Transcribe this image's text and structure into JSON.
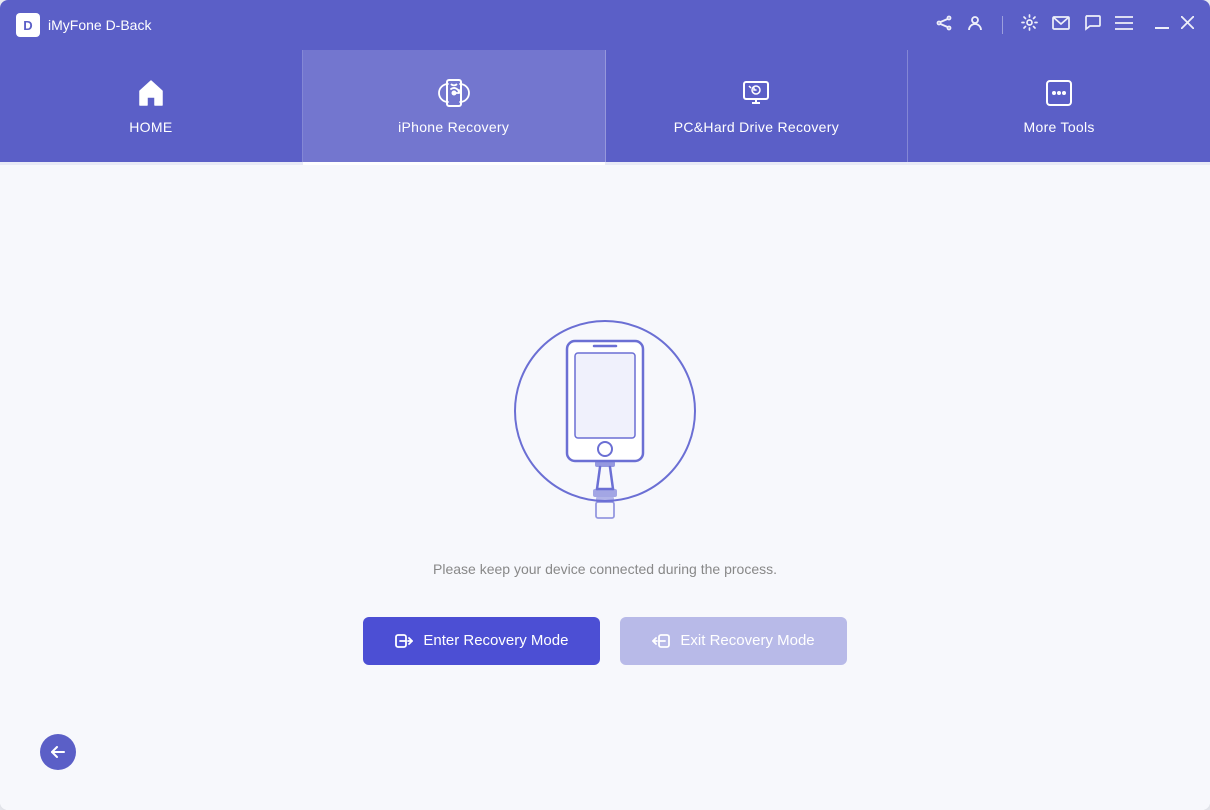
{
  "titlebar": {
    "logo_letter": "D",
    "app_name": "iMyFone D-Back"
  },
  "navbar": {
    "items": [
      {
        "id": "home",
        "label": "HOME",
        "active": false
      },
      {
        "id": "iphone-recovery",
        "label": "iPhone Recovery",
        "active": true
      },
      {
        "id": "pc-hard-drive",
        "label": "PC&Hard Drive Recovery",
        "active": false
      },
      {
        "id": "more-tools",
        "label": "More Tools",
        "active": false
      }
    ]
  },
  "main": {
    "instruction": "Please keep your device connected during the process.",
    "enter_btn": "Enter Recovery Mode",
    "exit_btn": "Exit Recovery Mode"
  },
  "icons": {
    "share": "⬆",
    "account": "👤",
    "settings": "⚙",
    "mail": "✉",
    "chat": "💬",
    "menu": "☰",
    "minimize": "─",
    "close": "✕",
    "back_arrow": "←"
  }
}
